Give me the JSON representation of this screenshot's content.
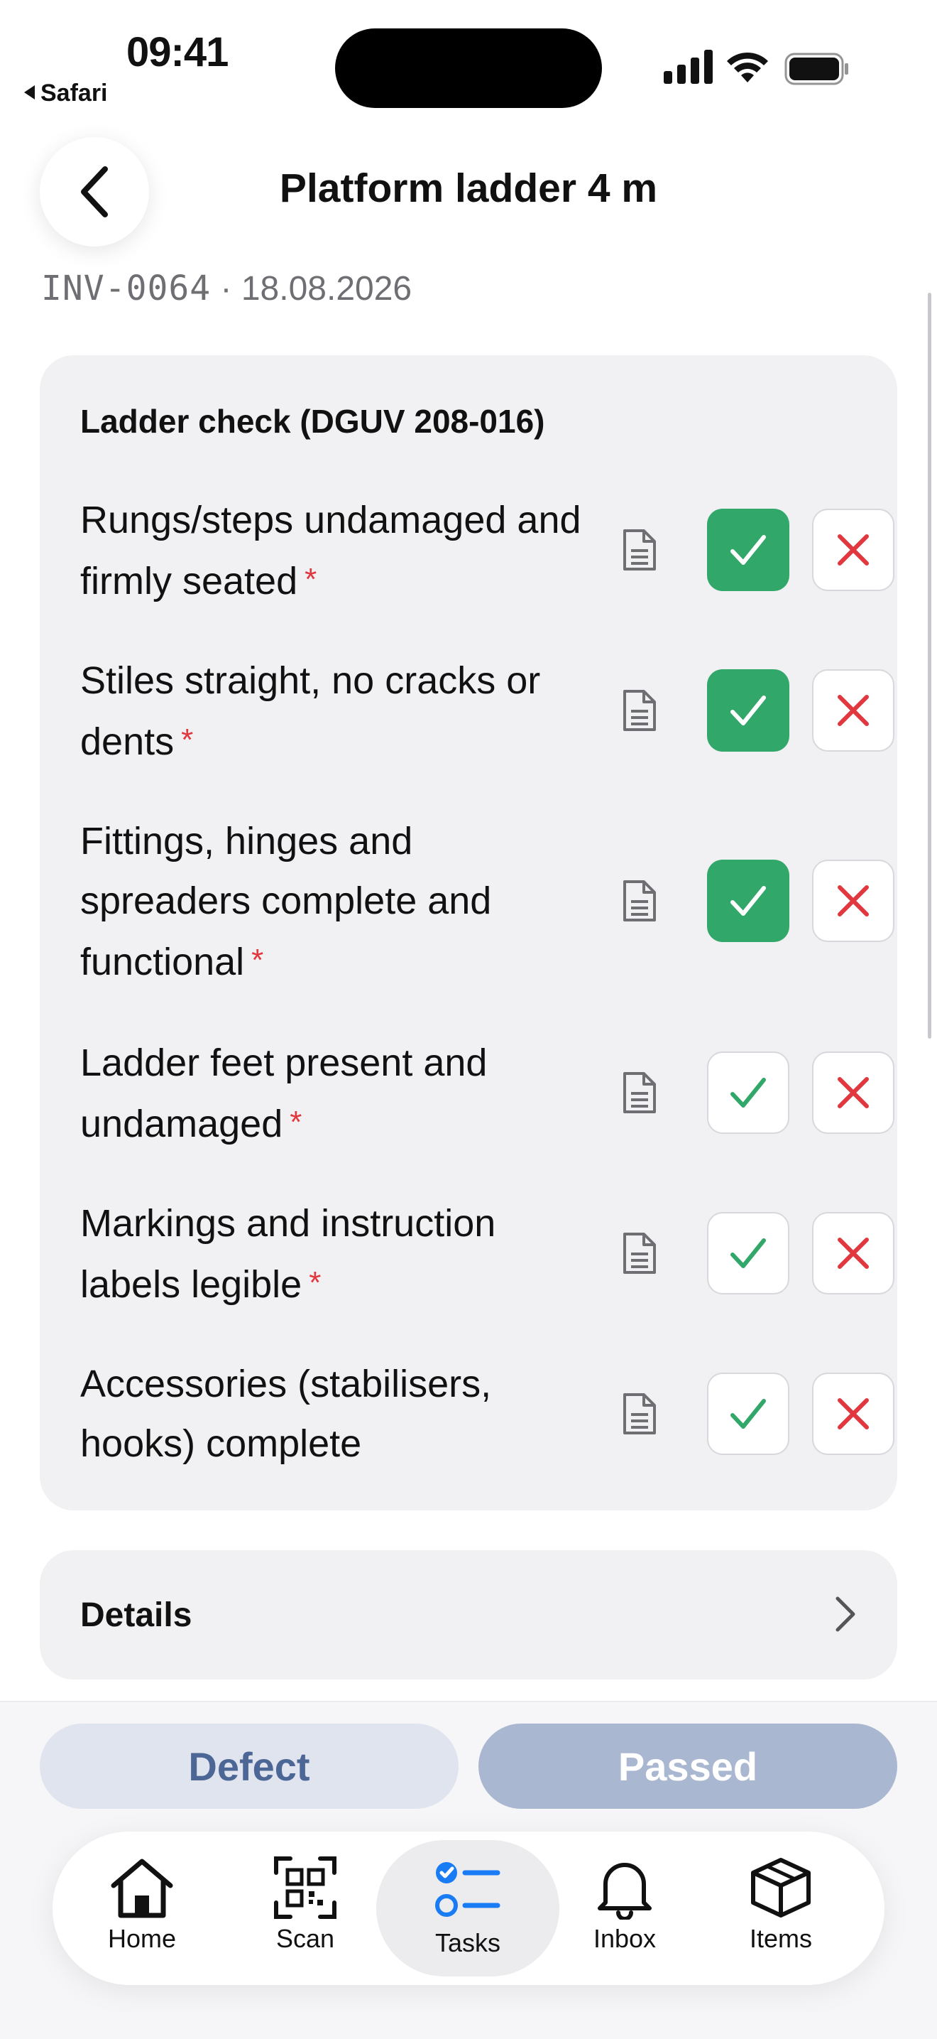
{
  "status_bar": {
    "time": "09:41",
    "back_app": "Safari"
  },
  "header": {
    "title": "Platform ladder 4 m"
  },
  "meta": {
    "inventory_id": "INV-0064",
    "separator": "·",
    "date": "18.08.2026"
  },
  "checklist": {
    "title": "Ladder check (DGUV 208-016)",
    "required_mark": "*",
    "items": [
      {
        "label": "Rungs/steps undamaged and firmly seated",
        "required": true,
        "status": "passed"
      },
      {
        "label": "Stiles straight, no cracks or dents",
        "required": true,
        "status": "passed"
      },
      {
        "label": "Fittings, hinges and spreaders complete and functional",
        "required": true,
        "status": "passed"
      },
      {
        "label": "Ladder feet present and undamaged",
        "required": true,
        "status": "unset"
      },
      {
        "label": "Markings and instruction labels legible",
        "required": true,
        "status": "unset"
      },
      {
        "label": "Accessories (stabilisers, hooks) complete",
        "required": false,
        "status": "unset"
      }
    ]
  },
  "details": {
    "label": "Details"
  },
  "actions": {
    "defect_label": "Defect",
    "passed_label": "Passed"
  },
  "tabbar": {
    "tabs": [
      {
        "label": "Home",
        "icon": "home-icon"
      },
      {
        "label": "Scan",
        "icon": "qr-scan-icon"
      },
      {
        "label": "Tasks",
        "icon": "tasks-icon",
        "active": true
      },
      {
        "label": "Inbox",
        "icon": "bell-icon"
      },
      {
        "label": "Items",
        "icon": "box-icon"
      }
    ]
  },
  "colors": {
    "pass_green": "#31a86a",
    "fail_red": "#e0383e",
    "accent_blue": "#1a7cf5",
    "defect_text": "#4c6796",
    "passed_button": "#a9b7d1",
    "card_bg": "#f1f1f3"
  }
}
